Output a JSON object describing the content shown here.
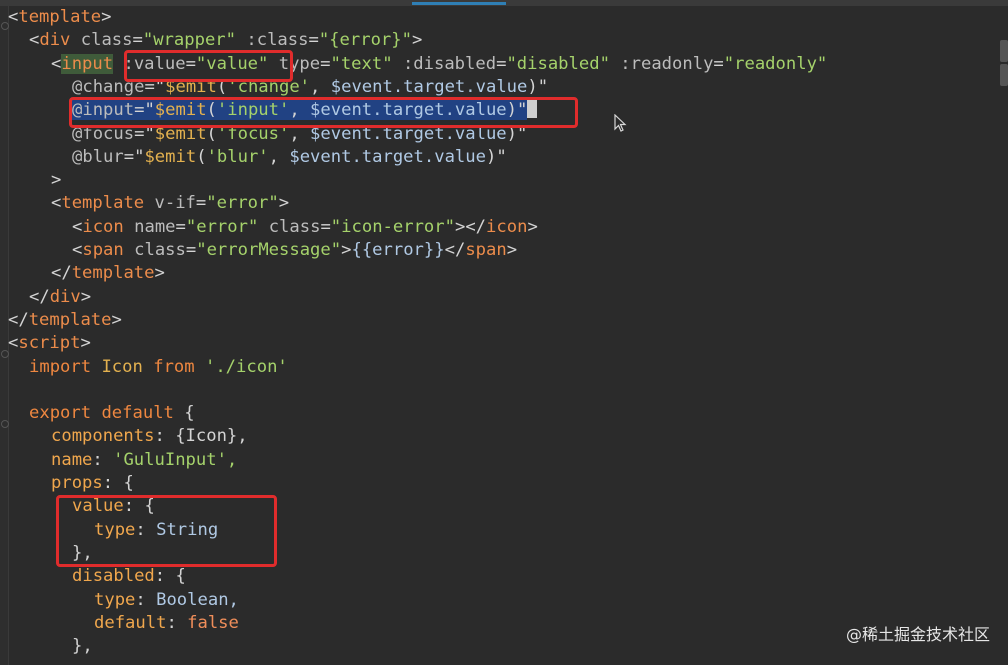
{
  "code": {
    "l1_tag": "template",
    "l2": {
      "tag": "div",
      "attr1": "class",
      "val1": "\"wrapper\"",
      "attr2": ":class",
      "val2": "\"{error}\""
    },
    "l3": {
      "tag": "input",
      "bind_attr": ":value",
      "bind_val": "\"value\"",
      "attr2": "type",
      "val2": "\"text\"",
      "attr3": ":disabled",
      "val3": "\"disabled\"",
      "attr4": ":readonly",
      "val4": "\"readonly\""
    },
    "l4": {
      "attr": "@change",
      "emit": "$emit",
      "arg": "'change'",
      "rest": "$event.target.value"
    },
    "l5": {
      "attr": "@input",
      "emit": "$emit",
      "arg": "'input'",
      "rest": "$event.target.value"
    },
    "l6": {
      "attr": "@focus",
      "emit": "$emit",
      "arg": "'focus'",
      "rest": "$event.target.value"
    },
    "l7": {
      "attr": "@blur",
      "emit": "$emit",
      "arg": "'blur'",
      "rest": "$event.target.value"
    },
    "l8": ">",
    "l9": {
      "tag": "template",
      "attr": "v-if",
      "val": "\"error\""
    },
    "l10": {
      "tag": "icon",
      "attr1": "name",
      "val1": "\"error\"",
      "attr2": "class",
      "val2": "\"icon-error\"",
      "close": "icon"
    },
    "l11": {
      "tag": "span",
      "attr": "class",
      "val": "\"errorMessage\"",
      "content": "{{error}}",
      "close": "span"
    },
    "l12": "template",
    "l13": "div",
    "l14": "template",
    "l15": "script",
    "l16": {
      "kw1": "import",
      "name": "Icon",
      "kw2": "from",
      "path": "'./icon'"
    },
    "l18": {
      "kw1": "export",
      "kw2": "default",
      "brace": "{"
    },
    "l19": {
      "key": "components",
      "val": "{Icon},"
    },
    "l20": {
      "key": "name",
      "val": "'GuluInput',"
    },
    "l21": {
      "key": "props",
      "brace": "{"
    },
    "l22": {
      "key": "value",
      "brace": "{"
    },
    "l23": {
      "key": "type",
      "val": "String"
    },
    "l24": "},",
    "l25": {
      "key": "disabled",
      "brace": "{"
    },
    "l26": {
      "key": "type",
      "val": "Boolean,"
    },
    "l27": {
      "key": "default",
      "val": "false"
    },
    "l28": "},"
  },
  "watermark": "@稀土掘金技术社区"
}
